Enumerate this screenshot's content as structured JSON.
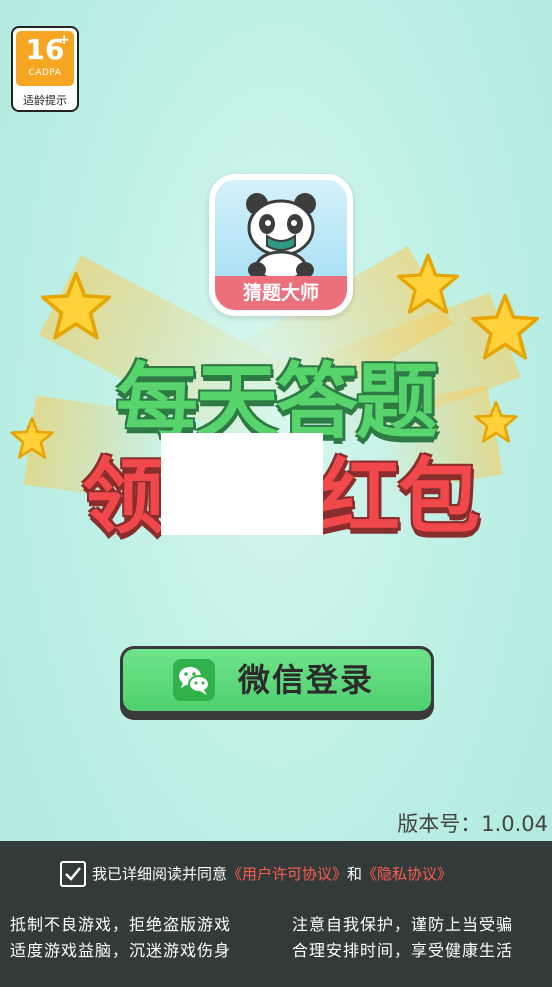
{
  "age_badge": {
    "number": "16",
    "plus": "+",
    "org": "CADPA",
    "caption": "适龄提示"
  },
  "app": {
    "name": "猜题大师"
  },
  "headline": {
    "line1": "每天答题",
    "line2_left": "领",
    "line2_right": "红包"
  },
  "login": {
    "label": "微信登录",
    "icon": "wechat-icon"
  },
  "version": "版本号：1.0.04",
  "agreement": {
    "prefix": "我已详细阅读并同意",
    "user_link": "《用户许可协议》",
    "and": "和",
    "privacy_link": "《隐私协议》",
    "checked": true
  },
  "notices": {
    "l1": "抵制不良游戏，拒绝盗版游戏",
    "r1": "注意自我保护，谨防上当受骗",
    "l2": "适度游戏益脑，沉迷游戏伤身",
    "r2": "合理安排时间，享受健康生活"
  },
  "colors": {
    "accent_green": "#58d46c",
    "accent_red": "#f0484b",
    "footer": "#323b3a",
    "link": "#ff5b4f"
  }
}
